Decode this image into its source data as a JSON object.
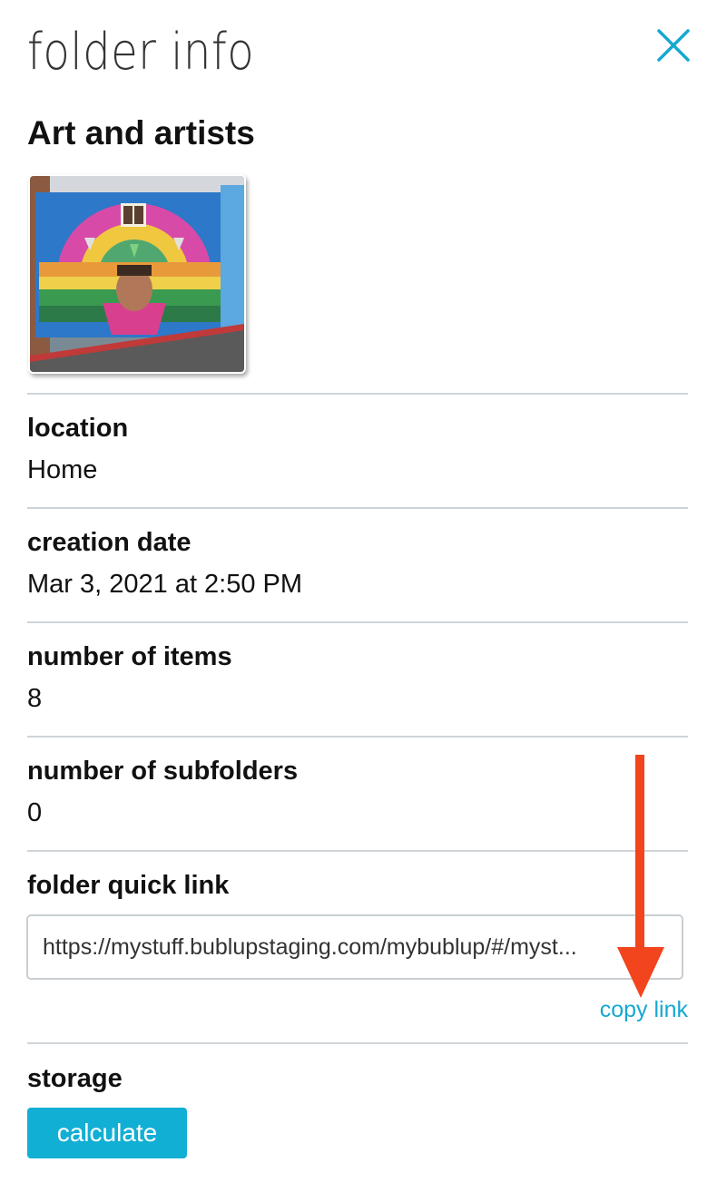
{
  "panel": {
    "title": "folder info",
    "close_icon": "close-icon"
  },
  "folder": {
    "name": "Art and artists",
    "thumbnail_icon": "mural-thumbnail"
  },
  "fields": {
    "location": {
      "label": "location",
      "value": "Home"
    },
    "creation_date": {
      "label": "creation date",
      "value": "Mar 3, 2021 at 2:50 PM"
    },
    "number_of_items": {
      "label": "number of items",
      "value": "8"
    },
    "number_of_subfolders": {
      "label": "number of subfolders",
      "value": "0"
    }
  },
  "quick_link": {
    "label": "folder quick link",
    "value": "https://mystuff.bublupstaging.com/mybublup/#/myst...",
    "copy_label": "copy link"
  },
  "storage": {
    "label": "storage",
    "button_label": "calculate"
  },
  "annotation": {
    "arrow_icon": "red-arrow-down-icon",
    "color": "#f2441d"
  },
  "colors": {
    "accent": "#16a8d0",
    "button": "#12afd4",
    "divider": "#cfd4d8"
  }
}
